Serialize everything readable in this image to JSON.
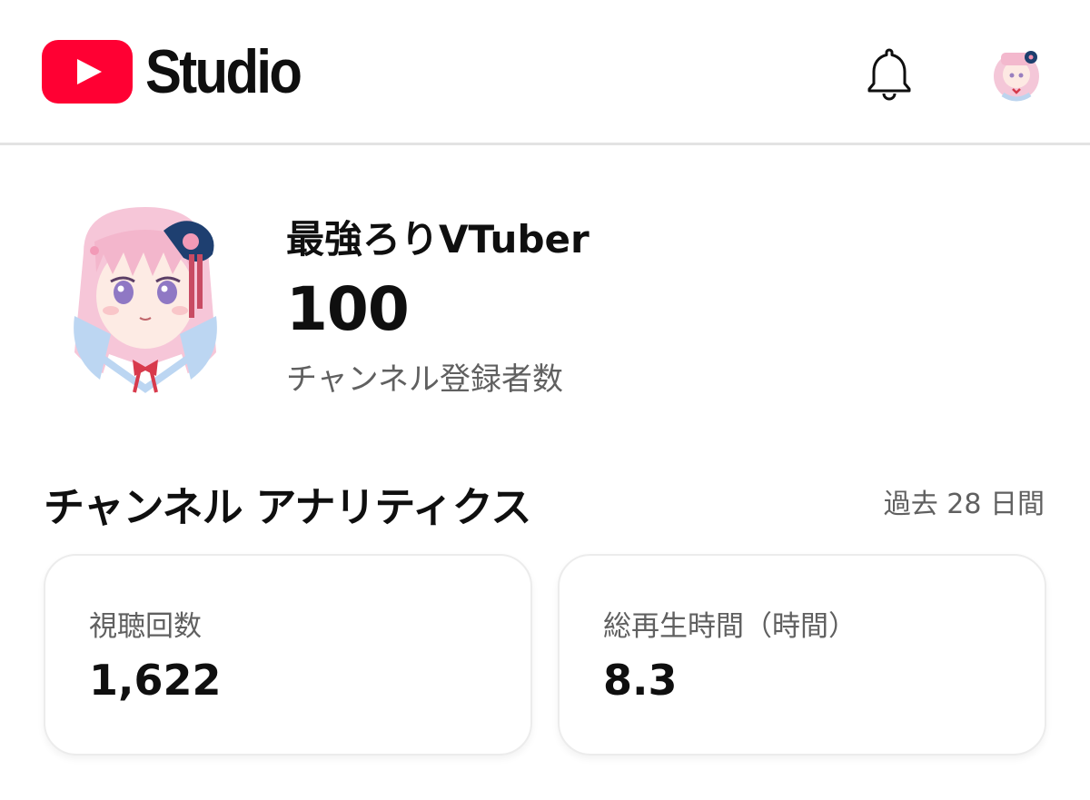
{
  "header": {
    "app_name": "Studio",
    "logo_icon": "youtube-play-icon",
    "brand_color": "#ff0033",
    "notifications_icon": "bell-icon",
    "account_icon": "avatar"
  },
  "channel": {
    "name": "最強ろりVTuber",
    "subscriber_count": "100",
    "subscriber_label": "チャンネル登録者数"
  },
  "analytics": {
    "title": "チャンネル アナリティクス",
    "period": "過去 28 日間",
    "cards": [
      {
        "label": "視聴回数",
        "value": "1,622"
      },
      {
        "label": "総再生時間（時間）",
        "value": "8.3"
      }
    ]
  }
}
